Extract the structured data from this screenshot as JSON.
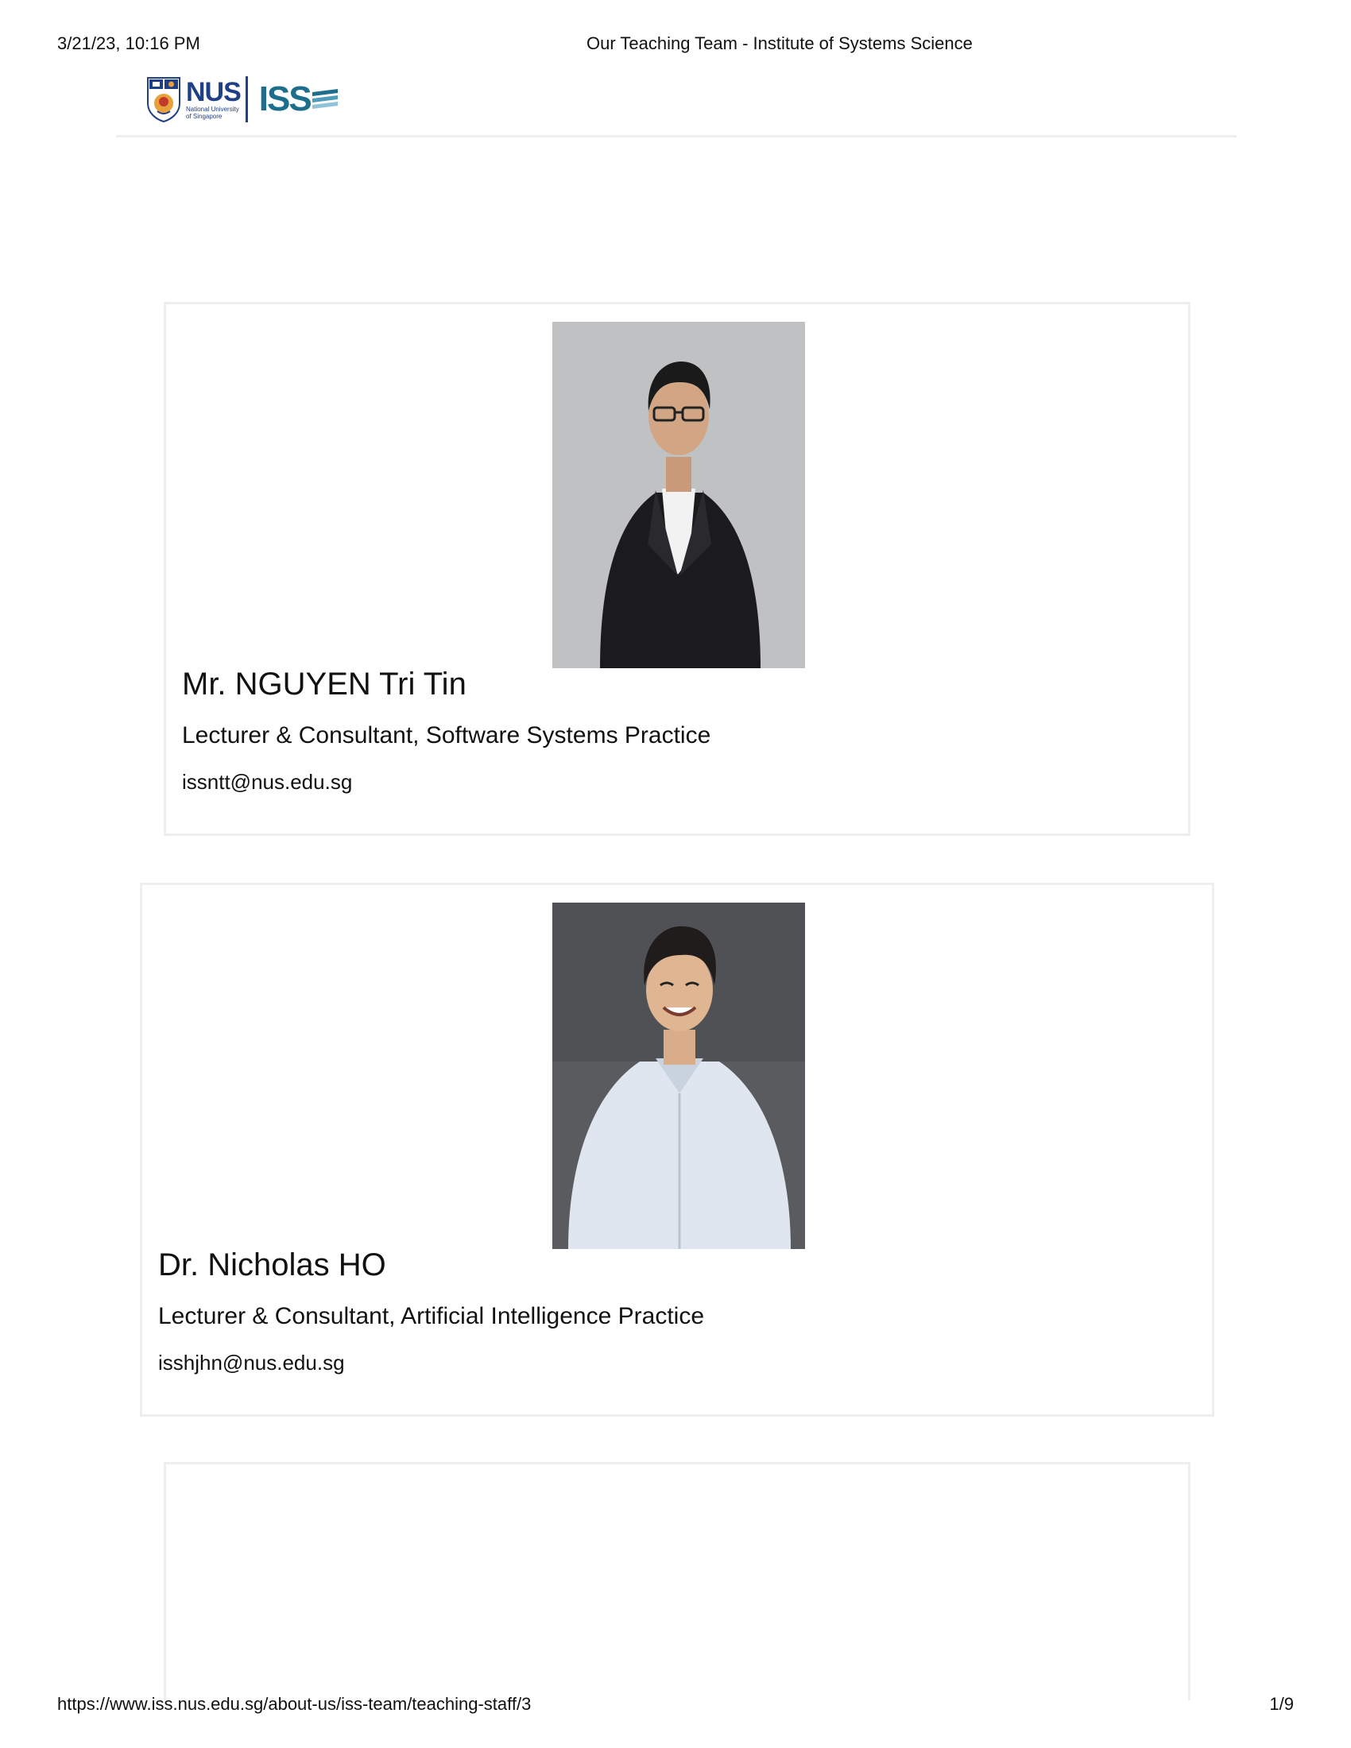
{
  "print_header": {
    "date": "3/21/23, 10:16 PM",
    "title": "Our Teaching Team - Institute of Systems Science"
  },
  "logo": {
    "nus_text": "NUS",
    "nus_subtitle_line1": "National University",
    "nus_subtitle_line2": "of Singapore",
    "iss_text": "ISS",
    "colors": {
      "nus_blue": "#1f3f86",
      "iss_teal": "#1c6e8c"
    }
  },
  "staff": [
    {
      "name": "Mr. NGUYEN Tri Tin",
      "role": "Lecturer & Consultant, Software Systems Practice",
      "email": "issntt@nus.edu.sg",
      "photo_icon": "portrait-photo-icon"
    },
    {
      "name": "Dr. Nicholas HO",
      "role": "Lecturer & Consultant, Artificial Intelligence Practice",
      "email": "isshjhn@nus.edu.sg",
      "photo_icon": "portrait-photo-icon"
    }
  ],
  "print_footer": {
    "url": "https://www.iss.nus.edu.sg/about-us/iss-team/teaching-staff/3",
    "page": "1/9"
  }
}
